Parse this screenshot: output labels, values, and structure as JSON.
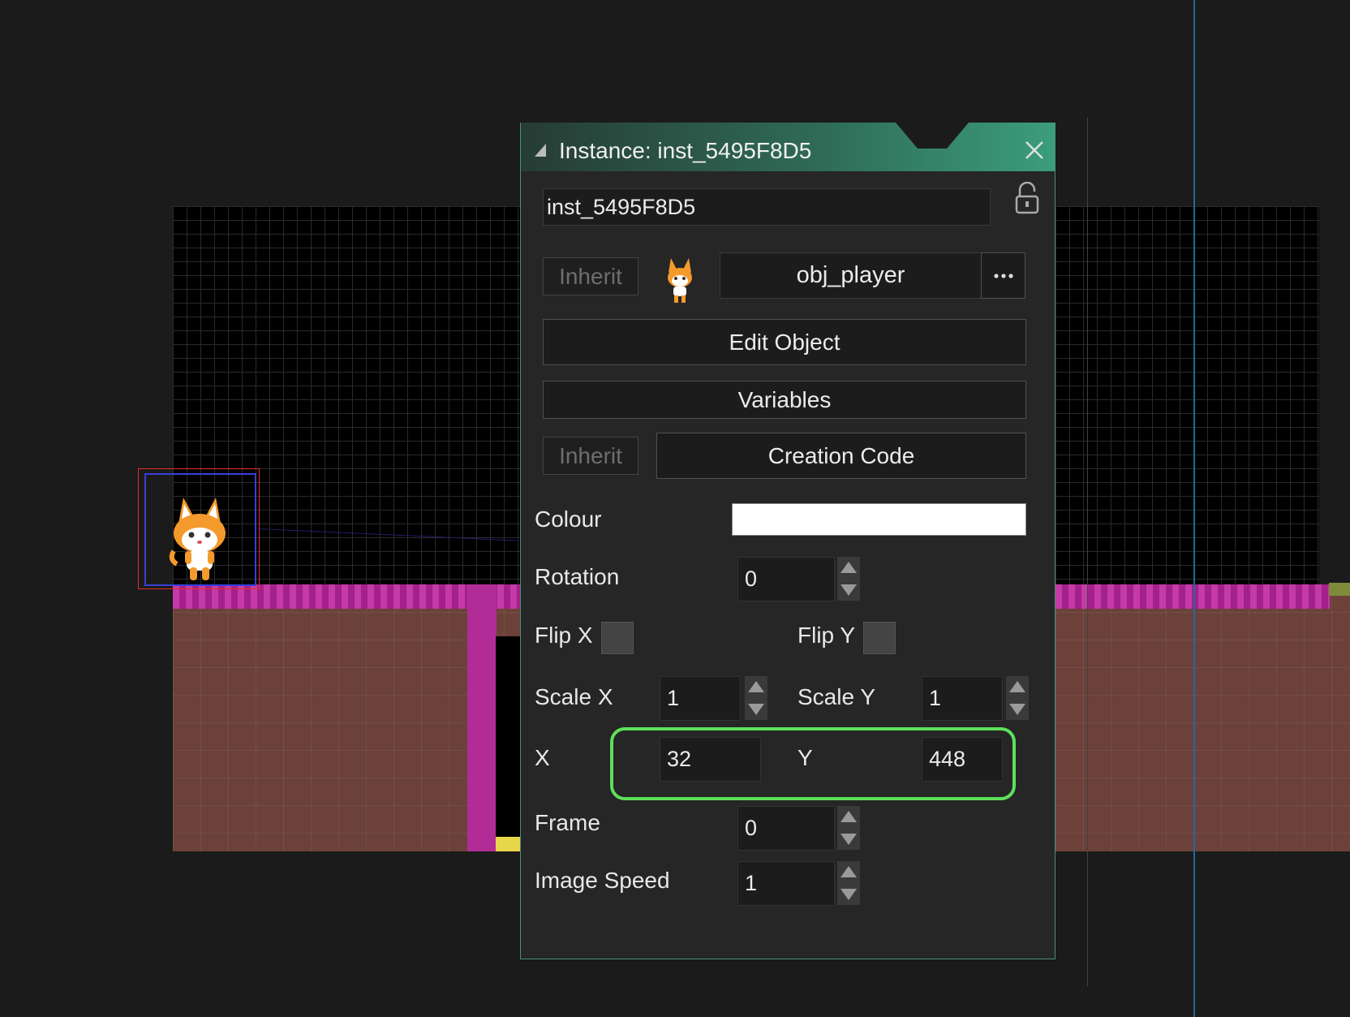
{
  "dialog": {
    "title": "Instance: inst_5495F8D5",
    "instance_name": "inst_5495F8D5",
    "inherit_label": "Inherit",
    "object_name": "obj_player",
    "more_label": "•••",
    "edit_object_label": "Edit Object",
    "variables_label": "Variables",
    "creation_code_label": "Creation Code",
    "colour_label": "Colour",
    "colour_value": "#FFFFFF",
    "rotation_label": "Rotation",
    "rotation_value": "0",
    "flip_x_label": "Flip X",
    "flip_y_label": "Flip Y",
    "scale_x_label": "Scale X",
    "scale_x_value": "1",
    "scale_y_label": "Scale Y",
    "scale_y_value": "1",
    "x_label": "X",
    "x_value": "32",
    "y_label": "Y",
    "y_value": "448",
    "frame_label": "Frame",
    "frame_value": "0",
    "image_speed_label": "Image Speed",
    "image_speed_value": "1"
  },
  "colors": {
    "titlebar_accent": "#3b9d7c",
    "highlight": "#5de05a",
    "selection_red": "#e0302a",
    "selection_blue": "#3a3fd6"
  },
  "icons": [
    "resize-icon",
    "close-icon",
    "lock-icon",
    "more-icon",
    "spin-up-icon",
    "spin-down-icon"
  ]
}
